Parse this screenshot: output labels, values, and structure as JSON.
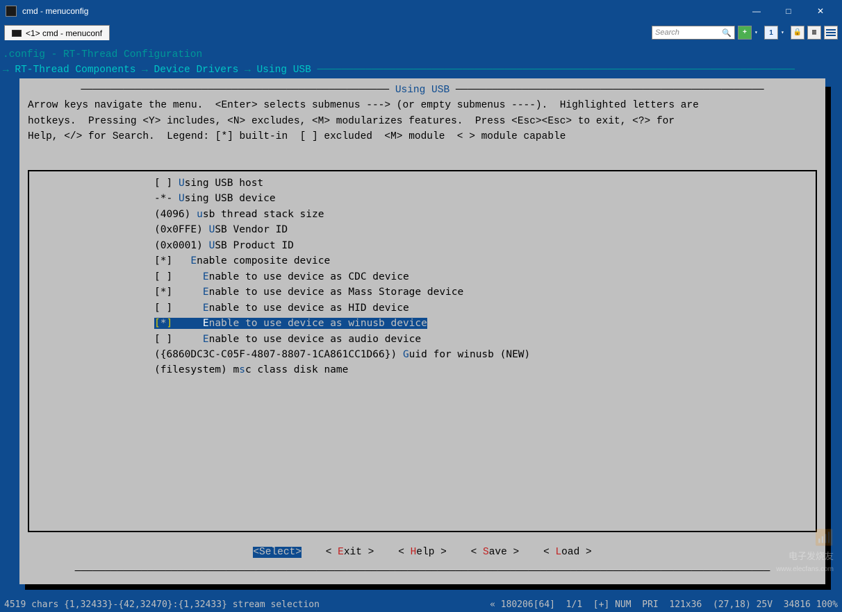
{
  "window": {
    "title": "cmd - menuconfig",
    "min": "—",
    "max": "□",
    "close": "✕"
  },
  "tabbar": {
    "tab_label": "<1> cmd - menuconf",
    "search_placeholder": "Search",
    "plus": "+",
    "one": "1"
  },
  "config": {
    "title_line": ".config - RT-Thread Configuration",
    "arrow": "→",
    "crumb1": "RT-Thread Components",
    "crumb2": "Device Drivers",
    "crumb3": "Using USB",
    "box_title": "Using USB"
  },
  "instructions": {
    "l1a": "Arrow keys navigate the menu.  <Enter> selects submenus ---> (or empty submenus ----).  Highlighted letters are",
    "l2a": "hotkeys.  Pressing <Y> includes, <N> excludes, <M> modularizes features.  Press <Esc><Esc> to exit, <?> for",
    "l3a": "Help, </> for Search.  Legend: [*] built-in  [ ] excluded  <M> module  < > module capable"
  },
  "items": [
    {
      "prefix": "[ ]",
      "hl": "U",
      "rest": "sing USB host",
      "indent": "",
      "sel": false
    },
    {
      "prefix": "-*-",
      "hl": "U",
      "rest": "sing USB device",
      "indent": "",
      "sel": false
    },
    {
      "prefix": "(4096)",
      "hl": "u",
      "rest": "sb thread stack size",
      "indent": "",
      "sel": false
    },
    {
      "prefix": "(0x0FFE)",
      "hl": "U",
      "rest": "SB Vendor ID",
      "indent": "",
      "sel": false
    },
    {
      "prefix": "(0x0001)",
      "hl": "U",
      "rest": "SB Product ID",
      "indent": "",
      "sel": false
    },
    {
      "prefix": "[*]",
      "hl": "E",
      "rest": "nable composite device",
      "indent": "  ",
      "sel": false
    },
    {
      "prefix": "[ ]",
      "hl": "E",
      "rest": "nable to use device as CDC device",
      "indent": "    ",
      "sel": false
    },
    {
      "prefix": "[*]",
      "hl": "E",
      "rest": "nable to use device as Mass Storage device",
      "indent": "    ",
      "sel": false
    },
    {
      "prefix": "[ ]",
      "hl": "E",
      "rest": "nable to use device as HID device",
      "indent": "    ",
      "sel": false
    },
    {
      "prefix": "[*]",
      "hl": "E",
      "rest": "nable to use device as winusb device",
      "indent": "    ",
      "sel": true
    },
    {
      "prefix": "[ ]",
      "hl": "E",
      "rest": "nable to use device as audio device",
      "indent": "    ",
      "sel": false
    },
    {
      "prefix": "({6860DC3C-C05F-4807-8807-1CA861CC1D66})",
      "hl": "G",
      "rest": "uid for winusb (NEW)",
      "indent": "",
      "sel": false
    },
    {
      "prefix": "(filesystem)",
      "hl": "",
      "rest": "sc class disk name",
      "hl2pos": "m",
      "sel": false
    }
  ],
  "buttons": {
    "select": "<Select>",
    "exit_l": "< ",
    "exit_h": "E",
    "exit_r": "xit >",
    "help_l": "< ",
    "help_h": "H",
    "help_r": "elp >",
    "save_l": "< ",
    "save_h": "S",
    "save_r": "ave >",
    "load_l": "< ",
    "load_h": "L",
    "load_r": "oad >"
  },
  "statusbar": {
    "left": "4519 chars {1,32433}-{42,32470}:{1,32433} stream selection",
    "right": "« 180206[64]  1/1  [+] NUM  PRI  121x36  (27,18) 25V  34816 100%"
  },
  "watermark": {
    "line1": "电子发烧友",
    "line2": "www.elecfans.com"
  }
}
